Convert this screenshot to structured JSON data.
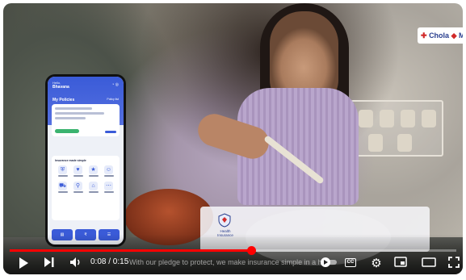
{
  "video": {
    "brand_text": "Chola",
    "brand_suffix": "MS",
    "hi_card_label": "Health Insurance",
    "phone": {
      "greeting": "Hello,",
      "name": "Bhavana",
      "policies_title": "My Policies",
      "policies_link": "Policy list",
      "simple_title": "Insurance made simple",
      "tabs": [
        "",
        "",
        ""
      ]
    }
  },
  "controls": {
    "time_display": "0:08 / 0:15",
    "caption": "With our pledge to protect, we make insurance simple in a hot agenda way",
    "cc_label": "CC",
    "progress": 0.54,
    "accent_color": "#ff0000",
    "icons": [
      "play-icon",
      "next-icon",
      "volume-icon",
      "autoplay-toggle-icon",
      "subtitles-icon",
      "settings-icon",
      "miniplayer-icon",
      "theater-icon",
      "fullscreen-icon"
    ]
  }
}
